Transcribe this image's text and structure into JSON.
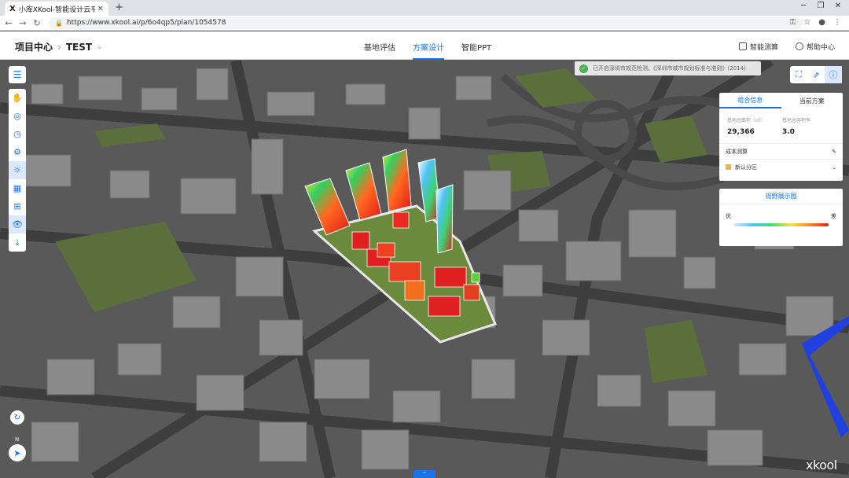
{
  "browser": {
    "tab_title": "小库XKool-智能设计云平台",
    "tab_logo": "X",
    "url": "https://www.xkool.ai/p/6o4qp5/plan/1054578"
  },
  "header": {
    "project_center": "项目中心",
    "project_name": "TEST",
    "tabs": [
      "基地评估",
      "方案设计",
      "智能PPT"
    ],
    "active_tab": "方案设计",
    "right_items": [
      "智能测算",
      "帮助中心"
    ]
  },
  "notice": {
    "text": "已开启深圳市规范检测。《深圳市城市规划标准与准则》(2014)"
  },
  "panel": {
    "tabs": [
      "组合信息",
      "当前方案"
    ],
    "stat1_label": "基地总面积（㎡）",
    "stat1_value": "29,366",
    "stat2_label": "基地总容积率",
    "stat2_value": "3.0",
    "cost_label": "成本测算",
    "zone_label": "新认分区"
  },
  "visibility": {
    "title": "视野展示图",
    "good": "优",
    "bad": "差"
  },
  "compass_label": "N",
  "watermark": "xkool",
  "colors": {
    "accent": "#1a73e8",
    "ground_green": "#5f7f3a",
    "heat_red": "#e02020",
    "heat_cyan": "#4fc3f7"
  }
}
